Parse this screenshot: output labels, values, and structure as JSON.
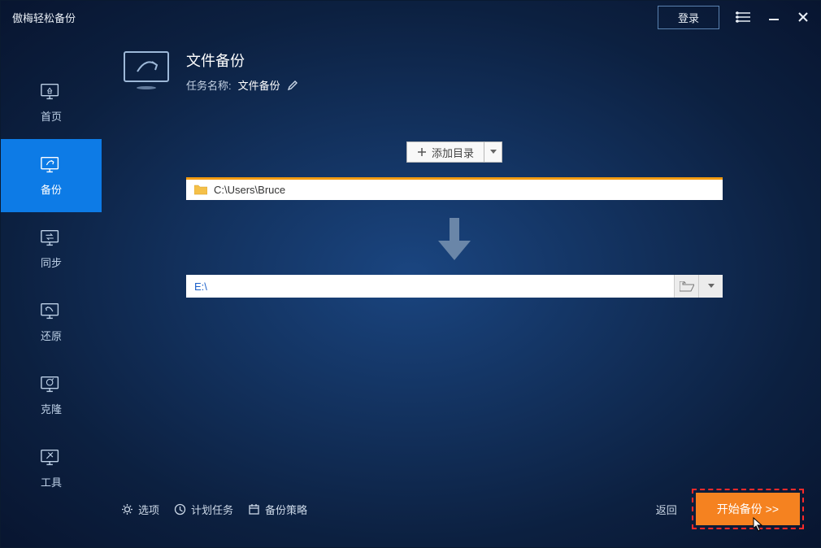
{
  "app": {
    "title": "傲梅轻松备份"
  },
  "titlebar": {
    "login": "登录"
  },
  "sidebar": {
    "items": [
      {
        "label": "首页"
      },
      {
        "label": "备份"
      },
      {
        "label": "同步"
      },
      {
        "label": "还原"
      },
      {
        "label": "克隆"
      },
      {
        "label": "工具"
      }
    ]
  },
  "header": {
    "title": "文件备份",
    "task_label": "任务名称:",
    "task_value": "文件备份"
  },
  "center": {
    "add_dir": "添加目录",
    "source_path": "C:\\Users\\Bruce",
    "dest_path": "E:\\"
  },
  "footer": {
    "options": "选项",
    "schedule": "计划任务",
    "strategy": "备份策略",
    "back": "返回",
    "start": "开始备份 >>"
  }
}
